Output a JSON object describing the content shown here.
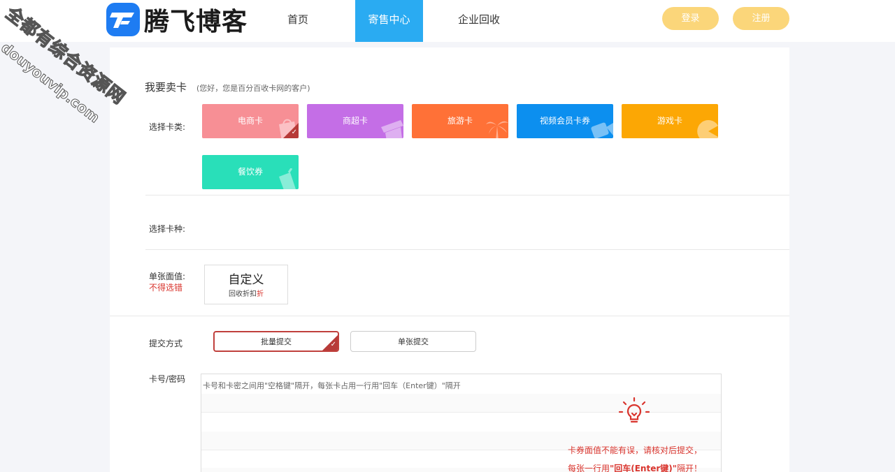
{
  "header": {
    "logo_text": "腾飞博客",
    "nav": [
      "首页",
      "寄售中心",
      "企业回收"
    ],
    "login_label": "登录",
    "register_label": "注册"
  },
  "sell": {
    "title": "我要卖卡",
    "subtitle": "(您好，您是百分百收卡网的客户)",
    "category_label": "选择卡类:",
    "categories": [
      {
        "label": "电商卡",
        "color": "#f78f95",
        "icon": "shopping-bag-icon",
        "selected": true
      },
      {
        "label": "商超卡",
        "color": "#c46ee6",
        "icon": "store-icon",
        "selected": false
      },
      {
        "label": "旅游卡",
        "color": "#ff7137",
        "icon": "palm-tree-icon",
        "selected": false
      },
      {
        "label": "视频会员卡券",
        "color": "#0c8fef",
        "icon": "video-icon",
        "selected": false
      },
      {
        "label": "游戏卡",
        "color": "#fca704",
        "icon": "pacman-icon",
        "selected": false
      },
      {
        "label": "餐饮券",
        "color": "#29dfb9",
        "icon": "drink-icon",
        "selected": false
      }
    ],
    "type_label": "选择卡种:",
    "value_label": "单张面值:",
    "value_warning": "不得选错",
    "custom_value": {
      "title": "自定义",
      "sub_prefix": "回收折扣",
      "sub_suffix": "折"
    },
    "submit_mode_label": "提交方式",
    "modes": [
      {
        "label": "批量提交",
        "selected": true
      },
      {
        "label": "单张提交",
        "selected": false
      }
    ],
    "card_pwd_label": "卡号/密码",
    "textarea_placeholder": "卡号和卡密之间用\"空格键\"隔开，每张卡占用一行用\"回车（Enter键）\"隔开",
    "hint_line1": "卡券面值不能有误，请核对后提交，",
    "hint_line2_prefix": "每张一行用",
    "hint_line2_key": "\"回车(Enter键)\"",
    "hint_line2_suffix": "隔开！"
  },
  "watermark": {
    "line1": "全都有综合资源网",
    "line2": "douyouvip.com"
  }
}
